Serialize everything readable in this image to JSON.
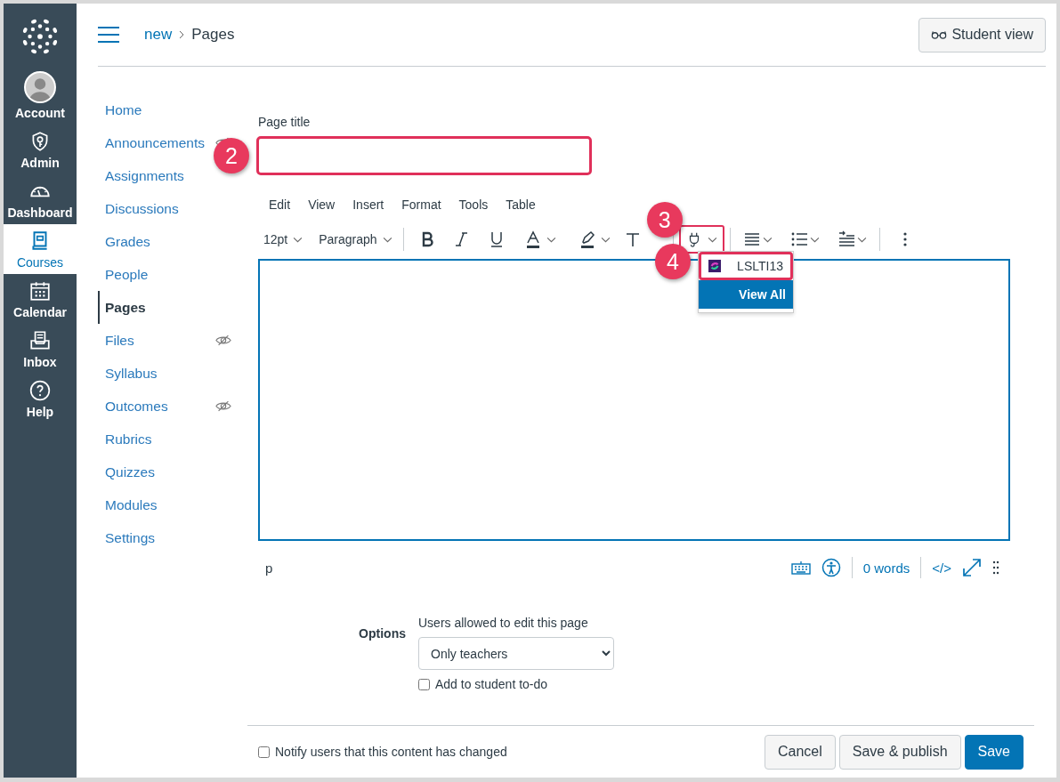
{
  "global_nav": [
    {
      "label": "Account",
      "selected": false
    },
    {
      "label": "Admin",
      "selected": false
    },
    {
      "label": "Dashboard",
      "selected": false
    },
    {
      "label": "Courses",
      "selected": true
    },
    {
      "label": "Calendar",
      "selected": false
    },
    {
      "label": "Inbox",
      "selected": false
    },
    {
      "label": "Help",
      "selected": false
    }
  ],
  "header": {
    "breadcrumb": [
      "new",
      "Pages"
    ],
    "student_view_button": "Student view"
  },
  "course_nav": [
    {
      "label": "Home",
      "selected": false,
      "hidden": false
    },
    {
      "label": "Announcements",
      "selected": false,
      "hidden": true
    },
    {
      "label": "Assignments",
      "selected": false,
      "hidden": false
    },
    {
      "label": "Discussions",
      "selected": false,
      "hidden": false
    },
    {
      "label": "Grades",
      "selected": false,
      "hidden": false
    },
    {
      "label": "People",
      "selected": false,
      "hidden": false
    },
    {
      "label": "Pages",
      "selected": true,
      "hidden": false
    },
    {
      "label": "Files",
      "selected": false,
      "hidden": true
    },
    {
      "label": "Syllabus",
      "selected": false,
      "hidden": false
    },
    {
      "label": "Outcomes",
      "selected": false,
      "hidden": true
    },
    {
      "label": "Rubrics",
      "selected": false,
      "hidden": false
    },
    {
      "label": "Quizzes",
      "selected": false,
      "hidden": false
    },
    {
      "label": "Modules",
      "selected": false,
      "hidden": false
    },
    {
      "label": "Settings",
      "selected": false,
      "hidden": false
    }
  ],
  "page_title": {
    "label": "Page title",
    "highlighted": true,
    "badge": "2"
  },
  "editor": {
    "menu": [
      "Edit",
      "View",
      "Insert",
      "Format",
      "Tools",
      "Table"
    ],
    "font_size": "12pt",
    "block_format": "Paragraph",
    "plugin_button": {
      "highlighted": true,
      "badge": "3"
    },
    "plugin_menu": {
      "badge": "4",
      "items": [
        {
          "label": "LSLTI13",
          "highlighted": true,
          "selected": false
        },
        {
          "label": "View All",
          "highlighted": false,
          "selected": true
        }
      ]
    },
    "element_path": "p",
    "word_count": "0 words",
    "code_toggle": "</>"
  },
  "options": {
    "heading": "Options",
    "edit_label": "Users allowed to edit this page",
    "edit_select": "Only teachers",
    "todo": {
      "label": "Add to student to-do",
      "checked": false
    }
  },
  "footer": {
    "notify": {
      "label": "Notify users that this content has changed",
      "checked": false
    },
    "buttons": [
      {
        "label": "Cancel",
        "kind": "default"
      },
      {
        "label": "Save & publish",
        "kind": "default"
      },
      {
        "label": "Save",
        "kind": "primary"
      }
    ]
  }
}
